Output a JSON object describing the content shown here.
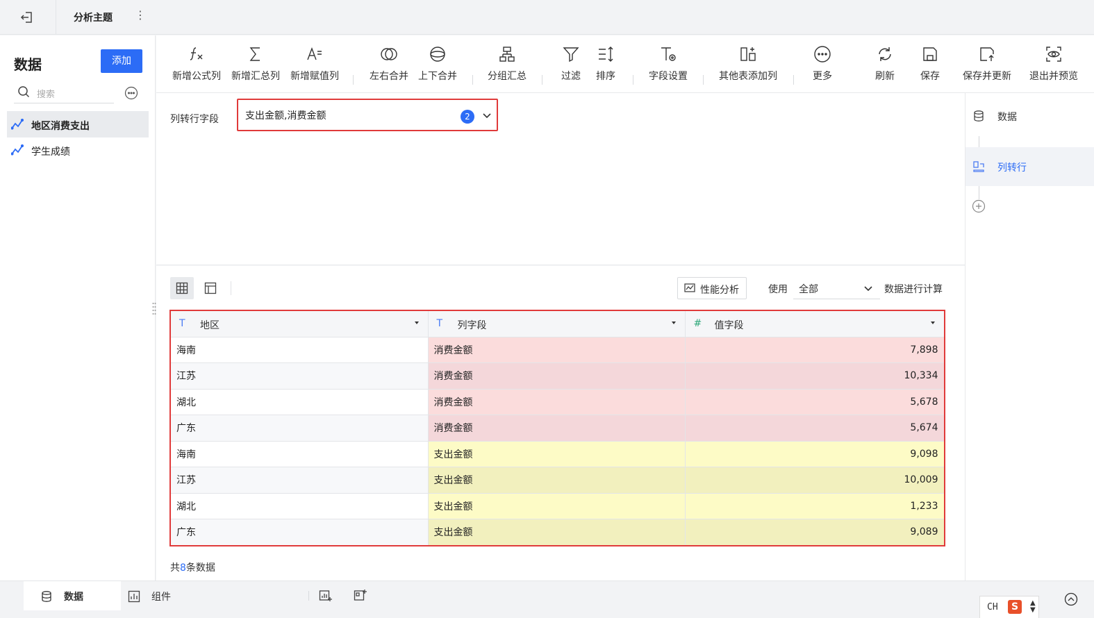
{
  "topbar": {
    "title": "分析主题",
    "more": "⋮"
  },
  "sidebar": {
    "heading": "数据",
    "add_label": "添加",
    "search_placeholder": "搜索",
    "items": [
      {
        "label": "地区消费支出",
        "active": true
      },
      {
        "label": "学生成绩",
        "active": false
      }
    ]
  },
  "toolbar": {
    "items": [
      {
        "label": "新增公式列",
        "icon": "formula-icon"
      },
      {
        "label": "新增汇总列",
        "icon": "sum-icon"
      },
      {
        "label": "新增赋值列",
        "icon": "assign-icon"
      },
      {
        "label": "左右合并",
        "icon": "merge-horizontal-icon"
      },
      {
        "label": "上下合并",
        "icon": "merge-vertical-icon"
      },
      {
        "label": "分组汇总",
        "icon": "group-summary-icon"
      },
      {
        "label": "过滤",
        "icon": "filter-icon"
      },
      {
        "label": "排序",
        "icon": "sort-icon"
      },
      {
        "label": "字段设置",
        "icon": "field-settings-icon"
      },
      {
        "label": "其他表添加列",
        "icon": "add-column-from-table-icon"
      },
      {
        "label": "更多",
        "icon": "more-icon"
      },
      {
        "label": "刷新",
        "icon": "refresh-icon"
      },
      {
        "label": "保存",
        "icon": "save-icon"
      },
      {
        "label": "保存并更新",
        "icon": "save-update-icon"
      },
      {
        "label": "退出并预览",
        "icon": "exit-preview-icon"
      }
    ]
  },
  "config": {
    "label": "列转行字段",
    "selected": "支出金额,消费金额",
    "count": "2"
  },
  "rail": {
    "steps": [
      {
        "label": "数据",
        "icon": "database-icon"
      },
      {
        "label": "列转行",
        "icon": "unpivot-icon"
      }
    ]
  },
  "preview": {
    "perf_label": "性能分析",
    "use_label": "使用",
    "use_value": "全部",
    "calc_label": "数据进行计算",
    "columns": [
      {
        "label": "地区",
        "type": "T"
      },
      {
        "label": "列字段",
        "type": "T"
      },
      {
        "label": "值字段",
        "type": "#"
      }
    ],
    "rows": [
      [
        "海南",
        "消费金额",
        "7,898"
      ],
      [
        "江苏",
        "消费金额",
        "10,334"
      ],
      [
        "湖北",
        "消费金额",
        "5,678"
      ],
      [
        "广东",
        "消费金额",
        "5,674"
      ],
      [
        "海南",
        "支出金额",
        "9,098"
      ],
      [
        "江苏",
        "支出金额",
        "10,009"
      ],
      [
        "湖北",
        "支出金额",
        "1,233"
      ],
      [
        "广东",
        "支出金额",
        "9,089"
      ]
    ],
    "count_prefix": "共",
    "count_value": "8",
    "count_suffix": "条数据"
  },
  "bottom": {
    "tabs": [
      {
        "label": "数据",
        "active": true
      },
      {
        "label": "组件",
        "active": false
      }
    ],
    "ime_lang": "CH",
    "ime_logo": "S"
  },
  "colors": {
    "accent": "#2c6cf6",
    "highlight_border": "#e03a3a",
    "pink_row": "#fbdcdc",
    "yellow_row": "#fdfbc6"
  }
}
